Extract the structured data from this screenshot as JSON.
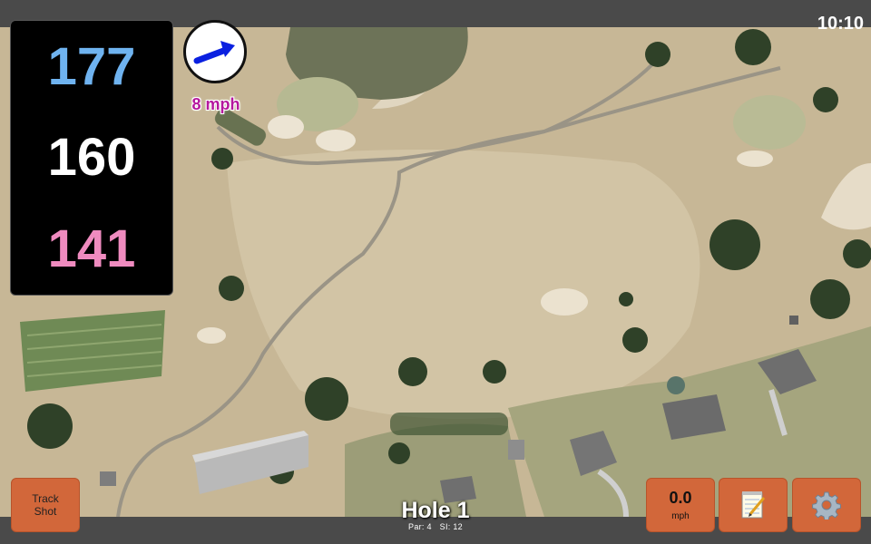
{
  "status": {
    "time": "10:10"
  },
  "yardages": {
    "back": "177",
    "middle": "160",
    "front": "141"
  },
  "wind": {
    "speed_label": "8 mph",
    "direction_icon": "arrow-right-icon"
  },
  "buttons": {
    "track_shot": "Track Shot",
    "wind_value": "0.0",
    "wind_unit": "mph",
    "notes_icon": "notepad-icon",
    "settings_icon": "gear-icon"
  },
  "hole": {
    "title": "Hole 1",
    "par": "Par: 4",
    "stroke_index": "SI: 12"
  },
  "colors": {
    "back_yardage": "#6fb3f0",
    "middle_yardage": "#ffffff",
    "front_yardage": "#ef8bbf",
    "wind_text": "#b5179e",
    "button_bg": "#d2673a",
    "arrow": "#0a20e0"
  }
}
